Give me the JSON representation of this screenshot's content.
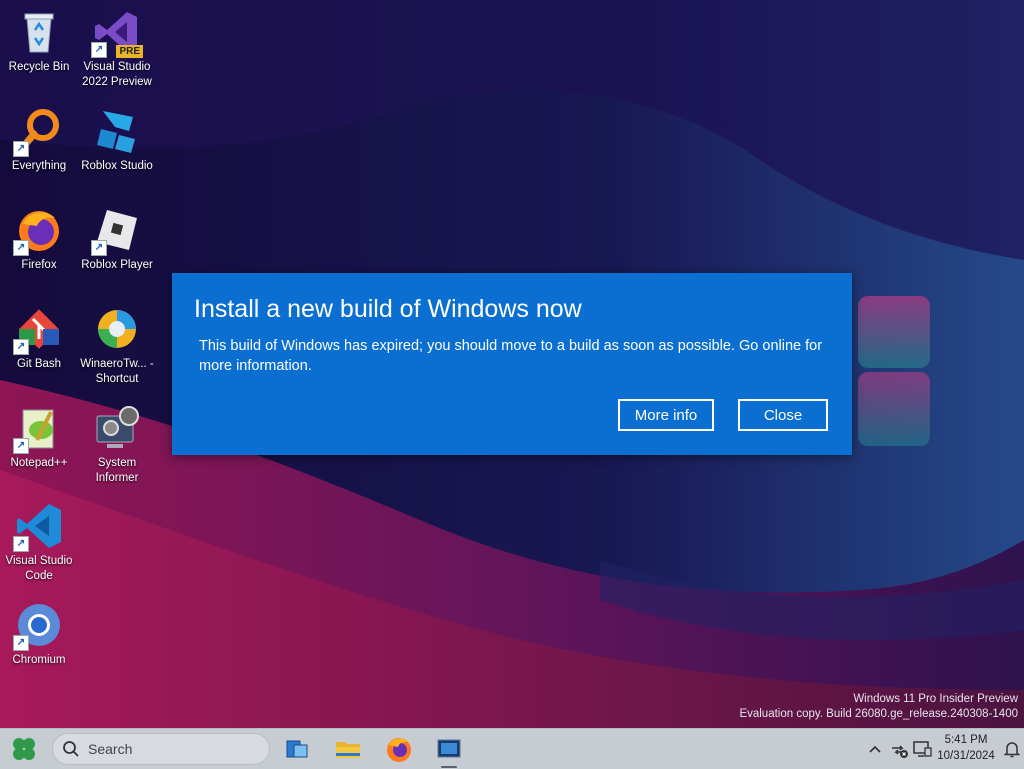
{
  "desktop": {
    "icons": [
      {
        "label": "Recycle Bin"
      },
      {
        "label": "Visual Studio 2022 Preview"
      },
      {
        "label": "Everything"
      },
      {
        "label": "Roblox Studio"
      },
      {
        "label": "Firefox"
      },
      {
        "label": "Roblox Player"
      },
      {
        "label": "Git Bash"
      },
      {
        "label": "WinaeroTw... - Shortcut"
      },
      {
        "label": "Notepad++"
      },
      {
        "label": "System Informer"
      },
      {
        "label": "Visual Studio Code"
      },
      {
        "label": "Chromium"
      }
    ],
    "vs_badge": "PRE",
    "watermark": {
      "line1": "Windows 11 Pro Insider Preview",
      "line2": "Evaluation copy. Build 26080.ge_release.240308-1400"
    }
  },
  "dialog": {
    "title": "Install a new build of Windows now",
    "message": "This build of Windows has expired; you should move to a build as soon as possible. Go online for more information.",
    "more_info_label": "More info",
    "close_label": "Close",
    "background": "#0a6fd0"
  },
  "taskbar": {
    "search_placeholder": "Search",
    "pinned": [
      "start-icon",
      "task-view-icon",
      "file-explorer-icon",
      "firefox-icon",
      "active-app-icon"
    ],
    "tray_icons": [
      "chevron-up-icon",
      "network-off-icon",
      "display-icon",
      "notification-icon"
    ],
    "clock": {
      "time": "5:41 PM",
      "date": "10/31/2024"
    },
    "background": "#c7cbd2"
  }
}
